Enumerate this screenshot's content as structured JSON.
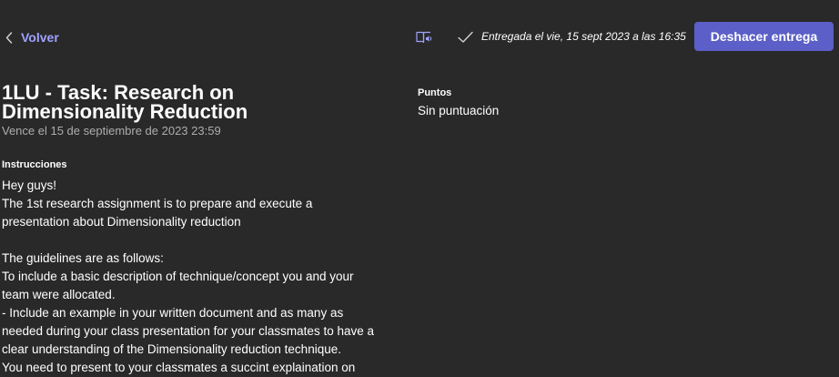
{
  "header": {
    "back_label": "Volver",
    "status_text": "Entregada el vie, 15 sept 2023 a las 16:35",
    "undo_button_label": "Deshacer entrega"
  },
  "icons": {
    "back": "chevron-left-icon",
    "reader": "immersive-reader-icon",
    "status": "checkmark-icon"
  },
  "assignment": {
    "title_line1": "1LU - Task: Research on",
    "title_line2": "Dimensionality Reduction",
    "due": "Vence el 15 de septiembre de 2023 23:59",
    "instructions_label": "Instrucciones",
    "instructions": [
      "Hey guys!",
      "The 1st research assignment is to prepare and execute a",
      "presentation about Dimensionality reduction",
      "",
      "The guidelines are as follows:",
      "To include a basic description of technique/concept you and your",
      "team were allocated.",
      "- Include an example in your written document and as many as",
      "needed during your class presentation for your classmates to have a",
      "clear understanding of the Dimensionality reduction technique.",
      "You need to present to your classmates a succint explaination on"
    ]
  },
  "points": {
    "label": "Puntos",
    "value": "Sin puntuación"
  },
  "colors": {
    "background": "#292929",
    "accent": "#5b5fc7",
    "link": "#9ea2ff",
    "muted_text": "#adadad"
  }
}
